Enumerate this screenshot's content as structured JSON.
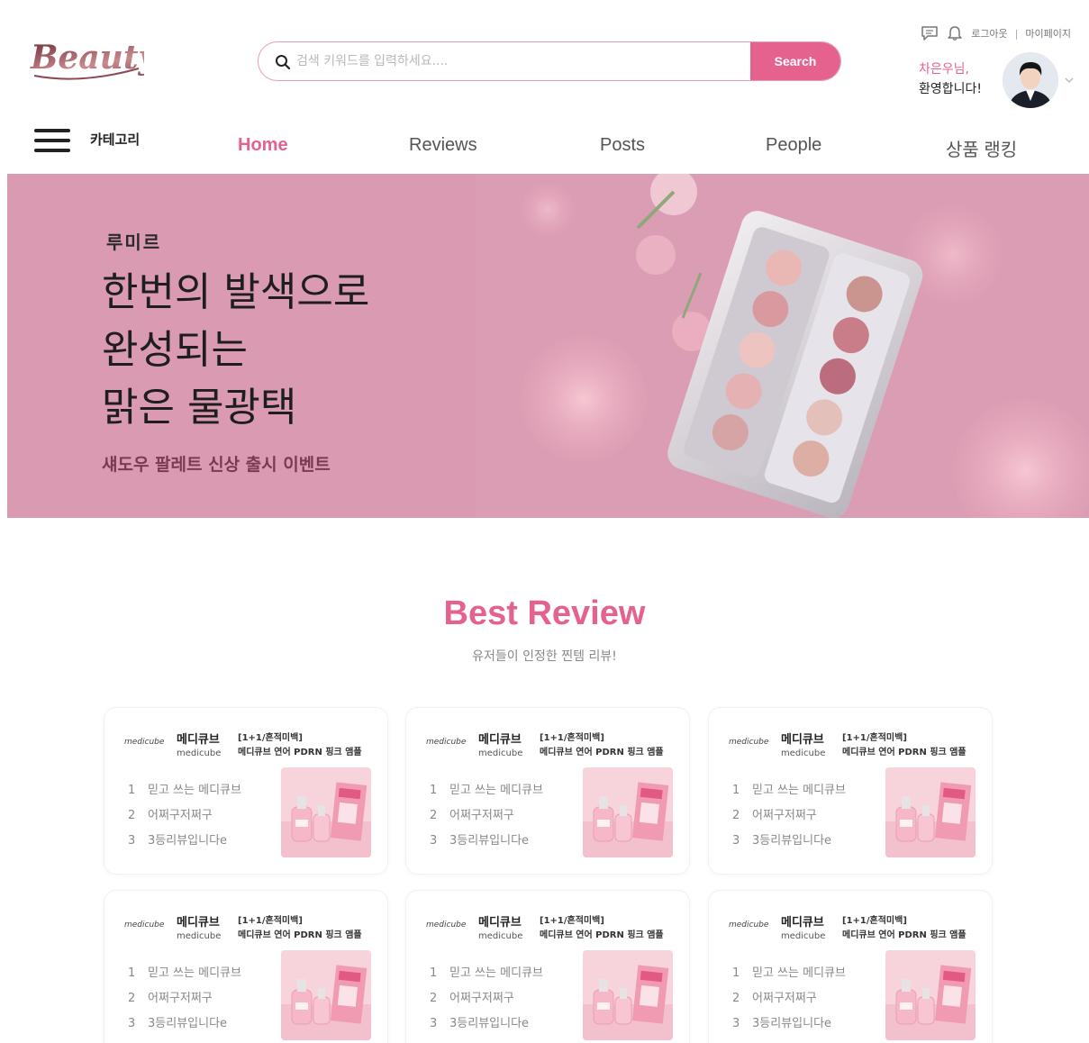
{
  "header": {
    "logo_text": "BeautyTalk",
    "search": {
      "placeholder": "검색 키워드를 입력하세요....",
      "button_label": "Search"
    },
    "util": {
      "logout_label": "로그아웃",
      "separator": "|",
      "mypage_label": "마이페이지"
    },
    "welcome": {
      "name": "차은우님,",
      "greeting": "환영합니다!"
    },
    "icons": [
      "chat-icon",
      "bell-icon",
      "chevron-down-icon",
      "menu-icon",
      "search-icon"
    ]
  },
  "nav": {
    "category_label": "카테고리",
    "items": [
      {
        "label": "Home",
        "active": true
      },
      {
        "label": "Reviews",
        "active": false
      },
      {
        "label": "Posts",
        "active": false
      },
      {
        "label": "People",
        "active": false
      },
      {
        "label": "상품 랭킹",
        "active": false
      }
    ]
  },
  "hero": {
    "brand": "루미르",
    "title_lines": [
      "한번의 발색으로",
      "완성되는",
      "맑은 물광택"
    ],
    "subtitle": "섀도우 팔레트 신상 출시 이벤트"
  },
  "best_review": {
    "title": "Best Review",
    "subtitle": "유저들이 인정한 찐템 리뷰!",
    "cards": [
      {
        "brand_logo": "medicube",
        "brand_ko": "메디큐브",
        "brand_en": "medicube",
        "product_tag": "[1+1/흔적미백]",
        "product_name": "메디큐브 연어 PDRN 핑크 앰플",
        "reviews": [
          "믿고 쓰는 메디큐브",
          "어쩌구저쩌구",
          "3등리뷰입니다e"
        ]
      },
      {
        "brand_logo": "medicube",
        "brand_ko": "메디큐브",
        "brand_en": "medicube",
        "product_tag": "[1+1/흔적미백]",
        "product_name": "메디큐브 연어 PDRN 핑크 앰플",
        "reviews": [
          "믿고 쓰는 메디큐브",
          "어쩌구저쩌구",
          "3등리뷰입니다e"
        ]
      },
      {
        "brand_logo": "medicube",
        "brand_ko": "메디큐브",
        "brand_en": "medicube",
        "product_tag": "[1+1/흔적미백]",
        "product_name": "메디큐브 연어 PDRN 핑크 앰플",
        "reviews": [
          "믿고 쓰는 메디큐브",
          "어쩌구저쩌구",
          "3등리뷰입니다e"
        ]
      },
      {
        "brand_logo": "medicube",
        "brand_ko": "메디큐브",
        "brand_en": "medicube",
        "product_tag": "[1+1/흔적미백]",
        "product_name": "메디큐브 연어 PDRN 핑크 앰플",
        "reviews": [
          "믿고 쓰는 메디큐브",
          "어쩌구저쩌구",
          "3등리뷰입니다e"
        ]
      },
      {
        "brand_logo": "medicube",
        "brand_ko": "메디큐브",
        "brand_en": "medicube",
        "product_tag": "[1+1/흔적미백]",
        "product_name": "메디큐브 연어 PDRN 핑크 앰플",
        "reviews": [
          "믿고 쓰는 메디큐브",
          "어쩌구저쩌구",
          "3등리뷰입니다e"
        ]
      },
      {
        "brand_logo": "medicube",
        "brand_ko": "메디큐브",
        "brand_en": "medicube",
        "product_tag": "[1+1/흔적미백]",
        "product_name": "메디큐브 연어 PDRN 핑크 앰플",
        "reviews": [
          "믿고 쓰는 메디큐브",
          "어쩌구저쩌구",
          "3등리뷰입니다e"
        ]
      }
    ]
  },
  "colors": {
    "accent": "#e5628e",
    "hero_bg": "#d99ab2",
    "text_dark": "#222222",
    "text_muted": "#888888"
  }
}
